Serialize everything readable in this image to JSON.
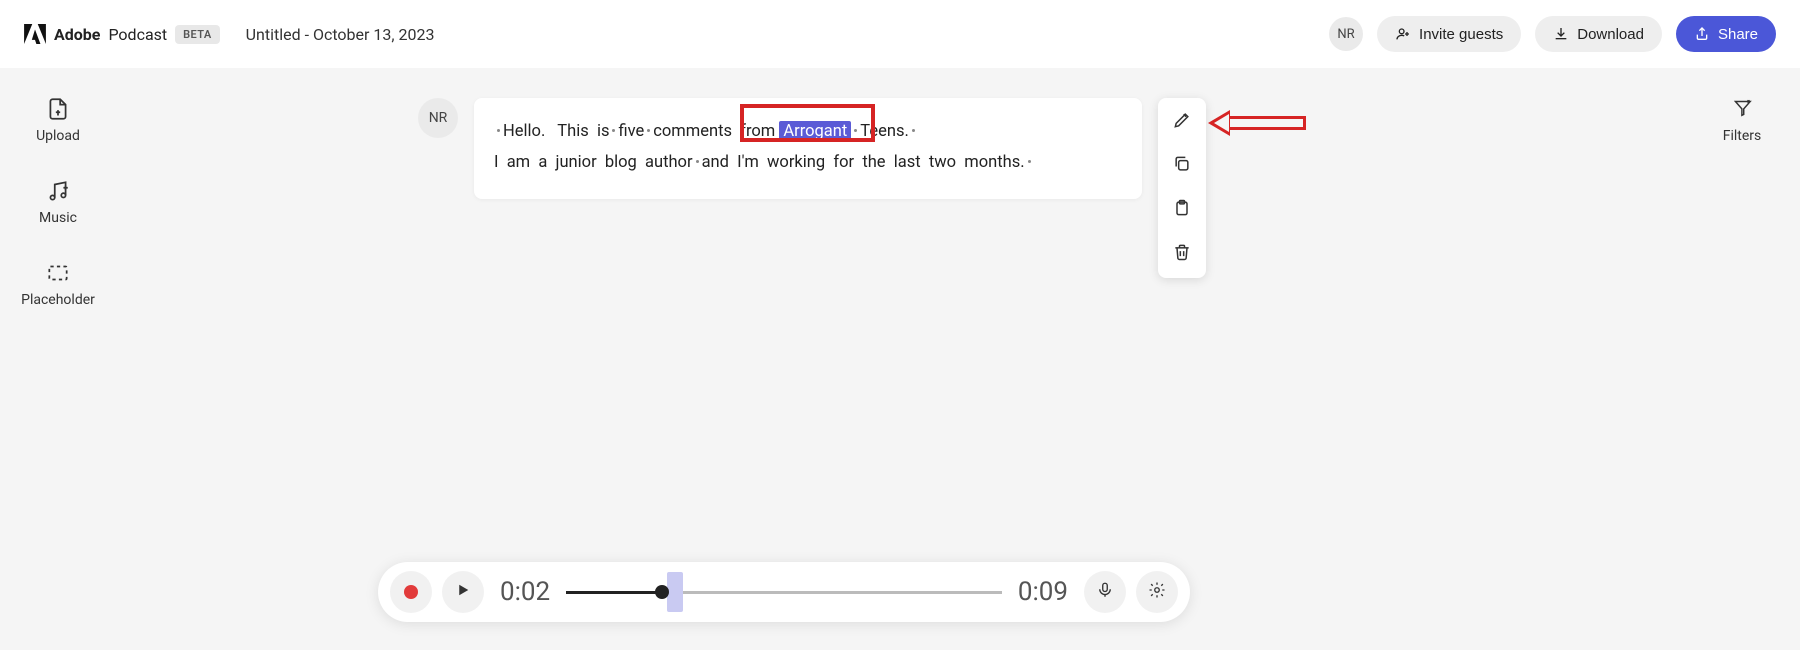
{
  "header": {
    "brand_bold": "Adobe",
    "brand_sub": "Podcast",
    "beta_label": "BETA",
    "doc_title": "Untitled - October 13, 2023",
    "user_initials": "NR",
    "invite_label": "Invite guests",
    "download_label": "Download",
    "share_label": "Share"
  },
  "left_rail": {
    "upload": "Upload",
    "music": "Music",
    "placeholder": "Placeholder"
  },
  "right_rail": {
    "filters": "Filters"
  },
  "transcript": {
    "speaker_initials": "NR",
    "line1": {
      "w1": "Hello.",
      "w2": "This",
      "w3": "is",
      "w4": "five",
      "w5": "comments",
      "w6": "from",
      "highlight": "Arrogant",
      "w7": "Teens."
    },
    "line2": {
      "w1": "I",
      "w2": "am",
      "w3": "a",
      "w4": "junior",
      "w5": "blog",
      "w6": "author",
      "w7": "and",
      "w8": "I'm",
      "w9": "working",
      "w10": "for",
      "w11": "the",
      "w12": "last",
      "w13": "two",
      "w14": "months."
    }
  },
  "player": {
    "current_time": "0:02",
    "total_time": "0:09",
    "progress_pct": 22,
    "marker_pct": 25
  }
}
